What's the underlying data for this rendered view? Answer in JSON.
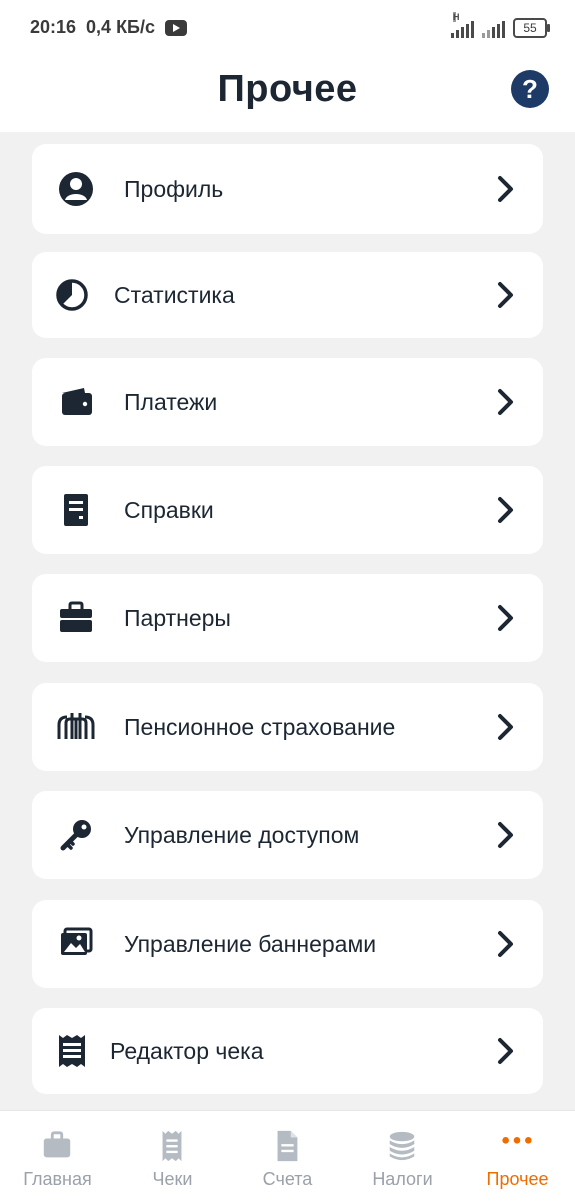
{
  "status": {
    "time": "20:16",
    "speed": "0,4 КБ/с",
    "network": "H",
    "battery": "55"
  },
  "header": {
    "title": "Прочее",
    "help": "?"
  },
  "menu": [
    {
      "label": "Профиль",
      "icon": "profile-icon"
    },
    {
      "label": "Статистика",
      "icon": "pie-chart-icon"
    },
    {
      "label": "Платежи",
      "icon": "wallet-icon"
    },
    {
      "label": "Справки",
      "icon": "document-icon"
    },
    {
      "label": "Партнеры",
      "icon": "briefcase-icon"
    },
    {
      "label": "Пенсионное страхование",
      "icon": "pension-fund-icon"
    },
    {
      "label": "Управление доступом",
      "icon": "key-icon"
    },
    {
      "label": "Управление баннерами",
      "icon": "image-icon"
    },
    {
      "label": "Редактор чека",
      "icon": "receipt-icon"
    }
  ],
  "tabs": [
    {
      "label": "Главная",
      "icon": "briefcase-icon"
    },
    {
      "label": "Чеки",
      "icon": "receipt-icon"
    },
    {
      "label": "Счета",
      "icon": "document-icon"
    },
    {
      "label": "Налоги",
      "icon": "coins-icon"
    },
    {
      "label": "Прочее",
      "icon": "more-dots-icon",
      "active": true
    }
  ],
  "colors": {
    "accent": "#ef6c00",
    "text": "#1c2733",
    "help_button": "#1d3b66",
    "inactive_tab": "#b5bbc2",
    "background": "#f1f1f1"
  }
}
